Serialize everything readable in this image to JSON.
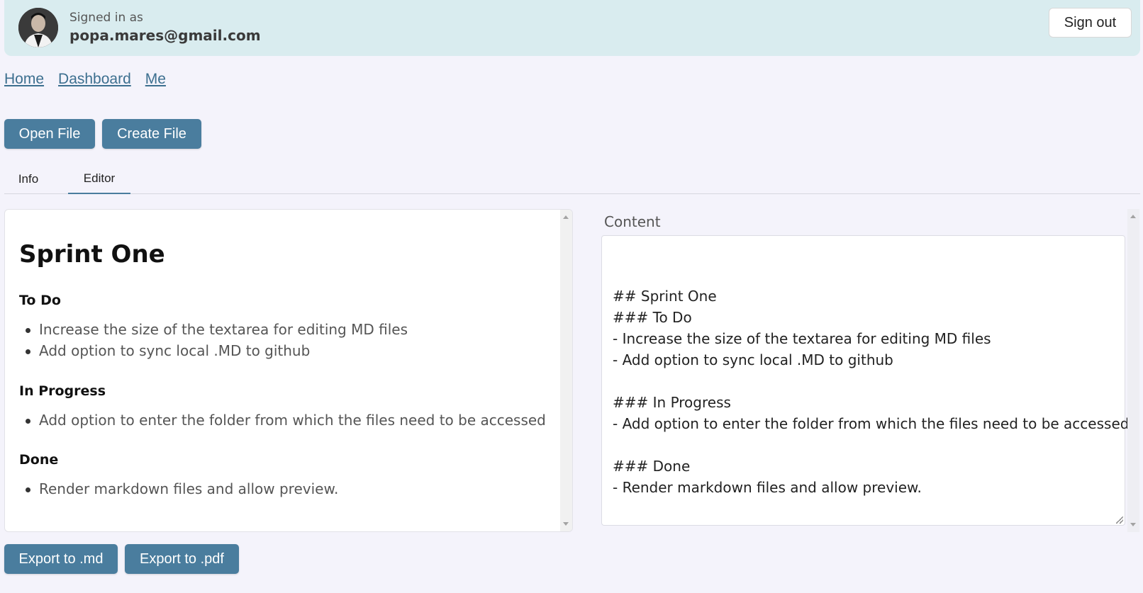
{
  "header": {
    "signed_in_label": "Signed in as",
    "email": "popa.mares@gmail.com",
    "sign_out_label": "Sign out"
  },
  "nav": {
    "links": [
      "Home",
      "Dashboard",
      "Me"
    ]
  },
  "file_actions": {
    "open_label": "Open File",
    "create_label": "Create File"
  },
  "tabs": [
    {
      "label": "Info",
      "active": false
    },
    {
      "label": "Editor",
      "active": true
    }
  ],
  "preview": {
    "title": "Sprint One",
    "sections": [
      {
        "heading": "To Do",
        "items": [
          "Increase the size of the textarea for editing MD files",
          "Add option to sync local .MD to github"
        ]
      },
      {
        "heading": "In Progress",
        "items": [
          "Add option to enter the folder from which the files need to be accessed"
        ]
      },
      {
        "heading": "Done",
        "items": [
          "Render markdown files and allow preview."
        ]
      }
    ]
  },
  "editor": {
    "label": "Content",
    "value": "## Sprint One\n### To Do\n- Increase the size of the textarea for editing MD files\n- Add option to sync local .MD to github\n\n### In Progress\n- Add option to enter the folder from which the files need to be accessed\n\n### Done\n- Render markdown files and allow preview."
  },
  "export": {
    "md_label": "Export to .md",
    "pdf_label": "Export to .pdf"
  },
  "colors": {
    "accent": "#4a7d9e",
    "header_bg": "#d9ecef",
    "page_bg": "#f4f3fb",
    "link": "#3c6f8f"
  },
  "icons": [
    "avatar-photo",
    "scroll-up-arrow",
    "scroll-down-arrow",
    "resize-grip-icon"
  ]
}
